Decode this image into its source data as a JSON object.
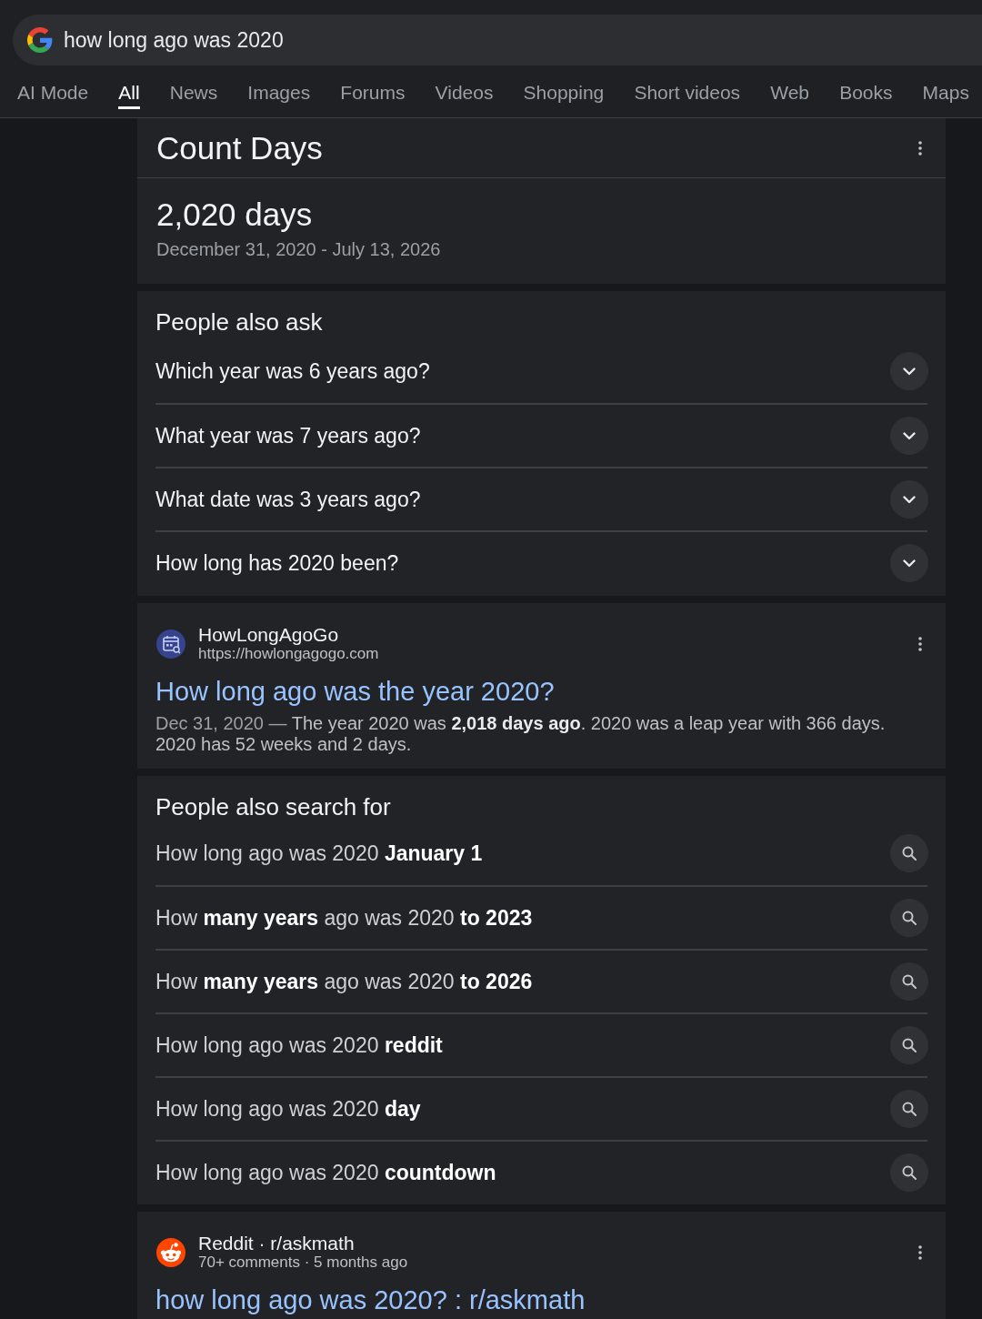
{
  "search_bar": {
    "query": "how long ago was 2020"
  },
  "tabs": [
    {
      "label": "AI Mode",
      "selected": false
    },
    {
      "label": "All",
      "selected": true
    },
    {
      "label": "News",
      "selected": false
    },
    {
      "label": "Images",
      "selected": false
    },
    {
      "label": "Forums",
      "selected": false
    },
    {
      "label": "Videos",
      "selected": false
    },
    {
      "label": "Shopping",
      "selected": false
    },
    {
      "label": "Short videos",
      "selected": false
    },
    {
      "label": "Web",
      "selected": false
    },
    {
      "label": "Books",
      "selected": false
    },
    {
      "label": "Maps",
      "selected": false
    }
  ],
  "blocks": [
    {
      "kind": "count_days",
      "title": "Count Days",
      "result": "2,020 days",
      "date_range": "December 31, 2020 - July 13, 2026"
    },
    {
      "kind": "questions",
      "title": "People also ask",
      "items": [
        {
          "text": "Which year was 6 years ago?",
          "expanded": false
        },
        {
          "text": "What year was 7 years ago?",
          "expanded": false
        },
        {
          "text": "What date was 3 years ago?",
          "expanded": false
        },
        {
          "text": "How long has 2020 been?",
          "expanded": false
        }
      ]
    },
    {
      "kind": "web_result",
      "site_name": "HowLongAgoGo",
      "url": "https://howlongagogo.com",
      "title": "How long ago was the year 2020?",
      "date": "Dec 31, 2020 —",
      "snippet": "The year 2020 was **2,018 days ago**. 2020 was a leap year with 366 days. 2020 has 52 weeks and 2 days."
    },
    {
      "kind": "related_searches",
      "title": "People also search for",
      "items": [
        {
          "text": "How long ago was 2020 **January 1**"
        },
        {
          "text": "How **many years** ago was 2020 **to 2023**"
        },
        {
          "text": "How **many years** ago was 2020 **to 2026**"
        },
        {
          "text": "How long ago was 2020 **reddit**"
        },
        {
          "text": "How long ago was 2020 **day**"
        },
        {
          "text": "How long ago was 2020 **countdown**"
        }
      ]
    },
    {
      "kind": "forum_result",
      "site_name": "Reddit · r/askmath",
      "meta": "70+ comments · 5 months ago",
      "title": "how long ago was 2020? : r/askmath"
    }
  ]
}
